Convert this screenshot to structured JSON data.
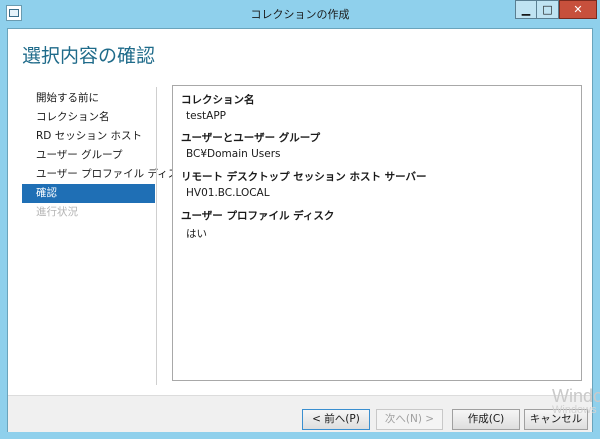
{
  "window": {
    "title": "コレクションの作成",
    "min_label": "▁",
    "max_label": "□",
    "close_label": "✕"
  },
  "page": {
    "title": "選択内容の確認"
  },
  "nav": {
    "items": [
      {
        "label": "開始する前に",
        "state": "normal"
      },
      {
        "label": "コレクション名",
        "state": "normal"
      },
      {
        "label": "RD セッション ホスト",
        "state": "normal"
      },
      {
        "label": "ユーザー グループ",
        "state": "normal"
      },
      {
        "label": "ユーザー プロファイル ディスク",
        "state": "normal"
      },
      {
        "label": "確認",
        "state": "active"
      },
      {
        "label": "進行状況",
        "state": "disabled"
      }
    ]
  },
  "summary": {
    "sections": [
      {
        "heading": "コレクション名",
        "value": "testAPP"
      },
      {
        "heading": "ユーザーとユーザー グループ",
        "value": "BC¥Domain Users"
      },
      {
        "heading": "リモート デスクトップ セッション ホスト サーバー",
        "value": "HV01.BC.LOCAL"
      },
      {
        "heading": "ユーザー プロファイル ディスク",
        "value": "はい"
      }
    ]
  },
  "buttons": {
    "back": "< 前へ(P)",
    "next": "次へ(N) >",
    "create": "作成(C)",
    "cancel": "キャンセル"
  },
  "watermark": {
    "line1": "Windo",
    "line2": "Windows"
  },
  "colors": {
    "frame": "#8fd0ec",
    "accent": "#1f6fb5",
    "title_text": "#1f6b8a",
    "close": "#c7503c"
  }
}
